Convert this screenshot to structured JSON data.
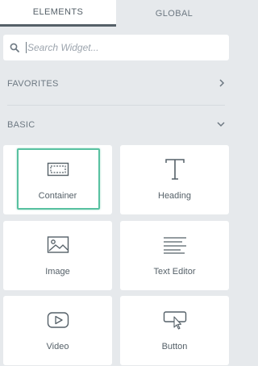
{
  "tabs": [
    {
      "label": "ELEMENTS",
      "active": true
    },
    {
      "label": "GLOBAL",
      "active": false
    }
  ],
  "search": {
    "placeholder": "Search Widget..."
  },
  "sections": {
    "favorites": {
      "label": "FAVORITES",
      "icon": "chevron-right-icon"
    },
    "basic": {
      "label": "BASIC",
      "icon": "chevron-down-icon"
    }
  },
  "widgets": [
    {
      "label": "Container",
      "icon": "container-icon"
    },
    {
      "label": "Heading",
      "icon": "heading-icon"
    },
    {
      "label": "Image",
      "icon": "image-icon"
    },
    {
      "label": "Text Editor",
      "icon": "text-editor-icon"
    },
    {
      "label": "Video",
      "icon": "video-icon"
    },
    {
      "label": "Button",
      "icon": "button-icon"
    }
  ],
  "colors": {
    "panel_bg": "#e6e9ec",
    "tile_bg": "#ffffff",
    "text": "#6d7882",
    "highlight": "#58c1a0"
  }
}
